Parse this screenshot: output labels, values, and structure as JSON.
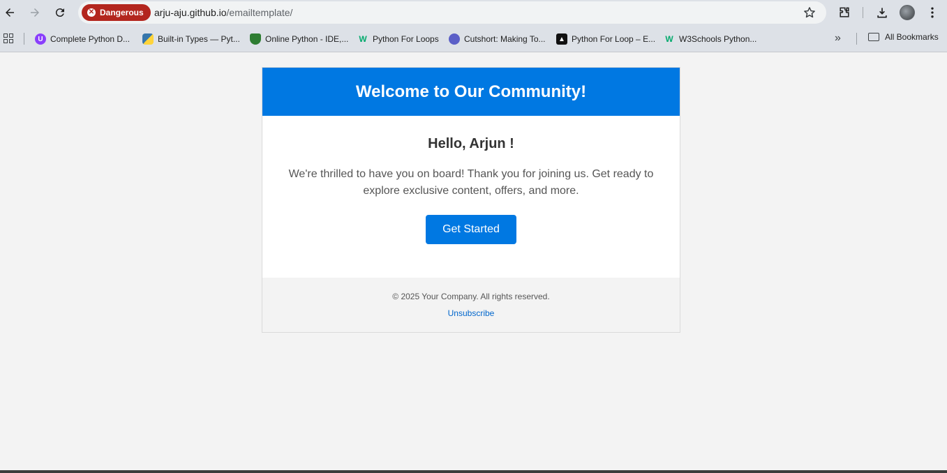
{
  "browser": {
    "security_chip": "Dangerous",
    "url_host": "arju-aju.github.io",
    "url_path": "/emailtemplate/"
  },
  "bookmarks": {
    "items": [
      {
        "label": "Complete Python D...",
        "icon": "udemy-icon",
        "color": "#8a3ffc"
      },
      {
        "label": "Built-in Types — Pyt...",
        "icon": "python-icon",
        "color": "#3776ab"
      },
      {
        "label": "Online Python - IDE,...",
        "icon": "shield-icon",
        "color": "#2e7d32"
      },
      {
        "label": "Python For Loops",
        "icon": "w3schools-icon",
        "color": "#04aa6d"
      },
      {
        "label": "Cutshort: Making To...",
        "icon": "cutshort-icon",
        "color": "#5b5fc7"
      },
      {
        "label": "Python For Loop – E...",
        "icon": "mountain-icon",
        "color": "#111111"
      },
      {
        "label": "W3Schools Python...",
        "icon": "w3schools-icon",
        "color": "#04aa6d"
      }
    ],
    "all_bookmarks": "All Bookmarks"
  },
  "email": {
    "header_title": "Welcome to Our Community!",
    "greeting": "Hello, Arjun !",
    "message": "We're thrilled to have you on board! Thank you for joining us. Get ready to explore exclusive content, offers, and more.",
    "cta_label": "Get Started",
    "footer_copy": "© 2025 Your Company. All rights reserved.",
    "unsubscribe": "Unsubscribe"
  },
  "colors": {
    "accent": "#0078e2",
    "danger": "#b3261e",
    "link": "#0066cc"
  }
}
